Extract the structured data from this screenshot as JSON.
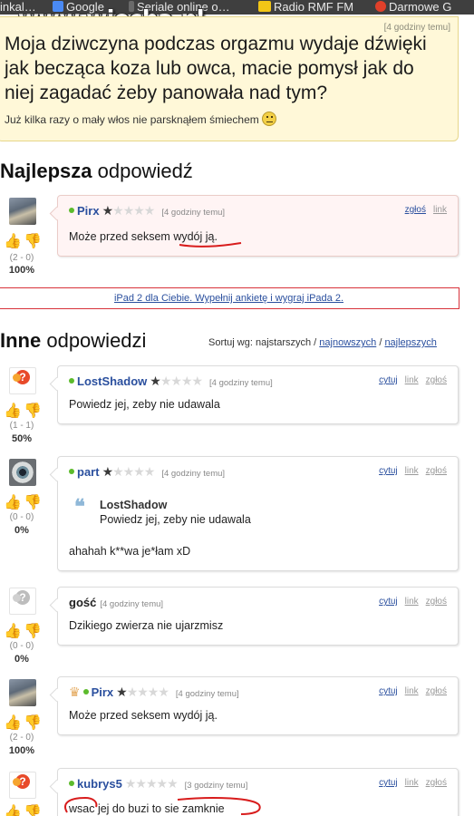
{
  "bookmarks": {
    "items": [
      {
        "label": "inkal…",
        "icon": "folder-icon"
      },
      {
        "label": "Google",
        "icon": "google-icon"
      },
      {
        "label": "Seriale online o…",
        "icon": "tv-icon"
      },
      {
        "label": "Radio RMF FM",
        "icon": "rmf-icon"
      },
      {
        "label": "Darmowe G",
        "icon": "gift-icon"
      }
    ]
  },
  "watermark": "www.wiocha.pl",
  "question": {
    "time": "[4 godziny temu]",
    "text": "Moja dziwczyna podczas orgazmu wydaje dźwięki jak becząca koza lub owca, macie pomysł jak do niej zagadać żeby panowała nad tym?",
    "sub": "Już kilka razy o mały włos nie parsknąłem śmiechem"
  },
  "best": {
    "heading_bold": "Najlepsza",
    "heading_rest": " odpowiedź",
    "author": "Pirx",
    "time": "[4 godziny temu]",
    "actions": [
      "zgłoś",
      "link"
    ],
    "text": "Może przed seksem wydój ją.",
    "score": "(2 - 0)",
    "percent": "100%",
    "rating": 1
  },
  "promo": "iPad 2 dla Ciebie. Wypełnij ankietę i wygraj iPada 2.",
  "others": {
    "heading_bold": "Inne",
    "heading_rest": " odpowiedzi",
    "sort_prefix": "Sortuj wg: najstarszych /",
    "sort_newest": "najnowszych",
    "sort_sep": " / ",
    "sort_best": "najlepszych"
  },
  "answers": [
    {
      "author": "LostShadow",
      "time": "[4 godziny temu]",
      "text": "Powiedz jej, zeby nie udawala",
      "score": "(1 - 1)",
      "percent": "50%",
      "rating": 1,
      "actions": [
        "cytuj",
        "link",
        "zgłoś"
      ]
    },
    {
      "author": "part",
      "time": "[4 godziny temu]",
      "quote_author": "LostShadow",
      "quote_text": "Powiedz jej, zeby nie udawala",
      "text": "ahahah k**wa je*łam xD",
      "score": "(0 - 0)",
      "percent": "0%",
      "rating": 1,
      "actions": [
        "cytuj",
        "link",
        "zgłoś"
      ]
    },
    {
      "author": "gość",
      "time": "[4 godziny temu]",
      "text": "Dzikiego zwierza nie ujarzmisz",
      "score": "(0 - 0)",
      "percent": "0%",
      "actions": [
        "cytuj",
        "link",
        "zgłoś"
      ]
    },
    {
      "author": "Pirx",
      "time": "[4 godziny temu]",
      "text": "Może przed seksem wydój ją.",
      "score": "(2 - 0)",
      "percent": "100%",
      "rating": 1,
      "actions": [
        "cytuj",
        "link",
        "zgłoś"
      ]
    },
    {
      "author": "kubrys5",
      "time": "[3 godziny temu]",
      "text": "wsac jej do buzi to sie zamknie",
      "rating": 0,
      "actions": [
        "cytuj",
        "link",
        "zgłoś"
      ]
    }
  ],
  "colors": {
    "author_link": "#2a4f9e",
    "online_dot": "#5cbb2c",
    "annotation_red": "#d81c1c",
    "question_bg": "#fff8d8"
  }
}
